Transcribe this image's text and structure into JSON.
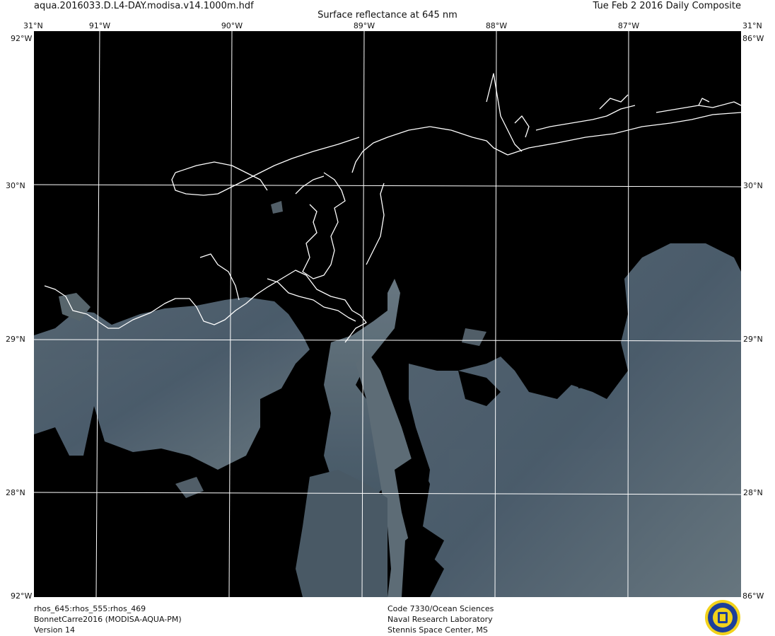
{
  "header": {
    "filename": "aqua.2016033.D.L4-DAY.modisa.v14.1000m.hdf",
    "date": "Tue Feb  2 2016 Daily Composite",
    "title": "Surface reflectance at 645 nm"
  },
  "axes": {
    "top_corner_left": "31°N",
    "top_corner_right": "31°N",
    "bottom_corner_left": "30°N",
    "bottom_corner_right": "30°N",
    "top_corner_lon_left": "92°W",
    "top_corner_lon_right": "86°W",
    "bottom_corner_lon_left": "92°W",
    "bottom_corner_lon_right": "86°W",
    "lon_labels": [
      "91°W",
      "90°W",
      "89°W",
      "88°W",
      "87°W"
    ],
    "lat_labels": [
      "30°N",
      "29°N",
      "28°N"
    ]
  },
  "footer": {
    "left": [
      "rhos_645:rhos_555:rhos_469",
      "BonnetCarre2016 (MODISA-AQUA-PM)",
      "Version 14"
    ],
    "center": [
      "Code 7330/Ocean Sciences",
      "Naval Research Laboratory",
      "Stennis Space Center, MS"
    ]
  },
  "colors": {
    "background": "#000000",
    "grid": "#ffffff",
    "coastline": "#ffffff",
    "cloud_haze": "#4f5f6c",
    "cloud_light": "#6b7c86",
    "logo_blue": "#1d3f9a",
    "logo_gold": "#f2d21b"
  },
  "icons": {
    "logo": "naval-research-laboratory-seal"
  }
}
